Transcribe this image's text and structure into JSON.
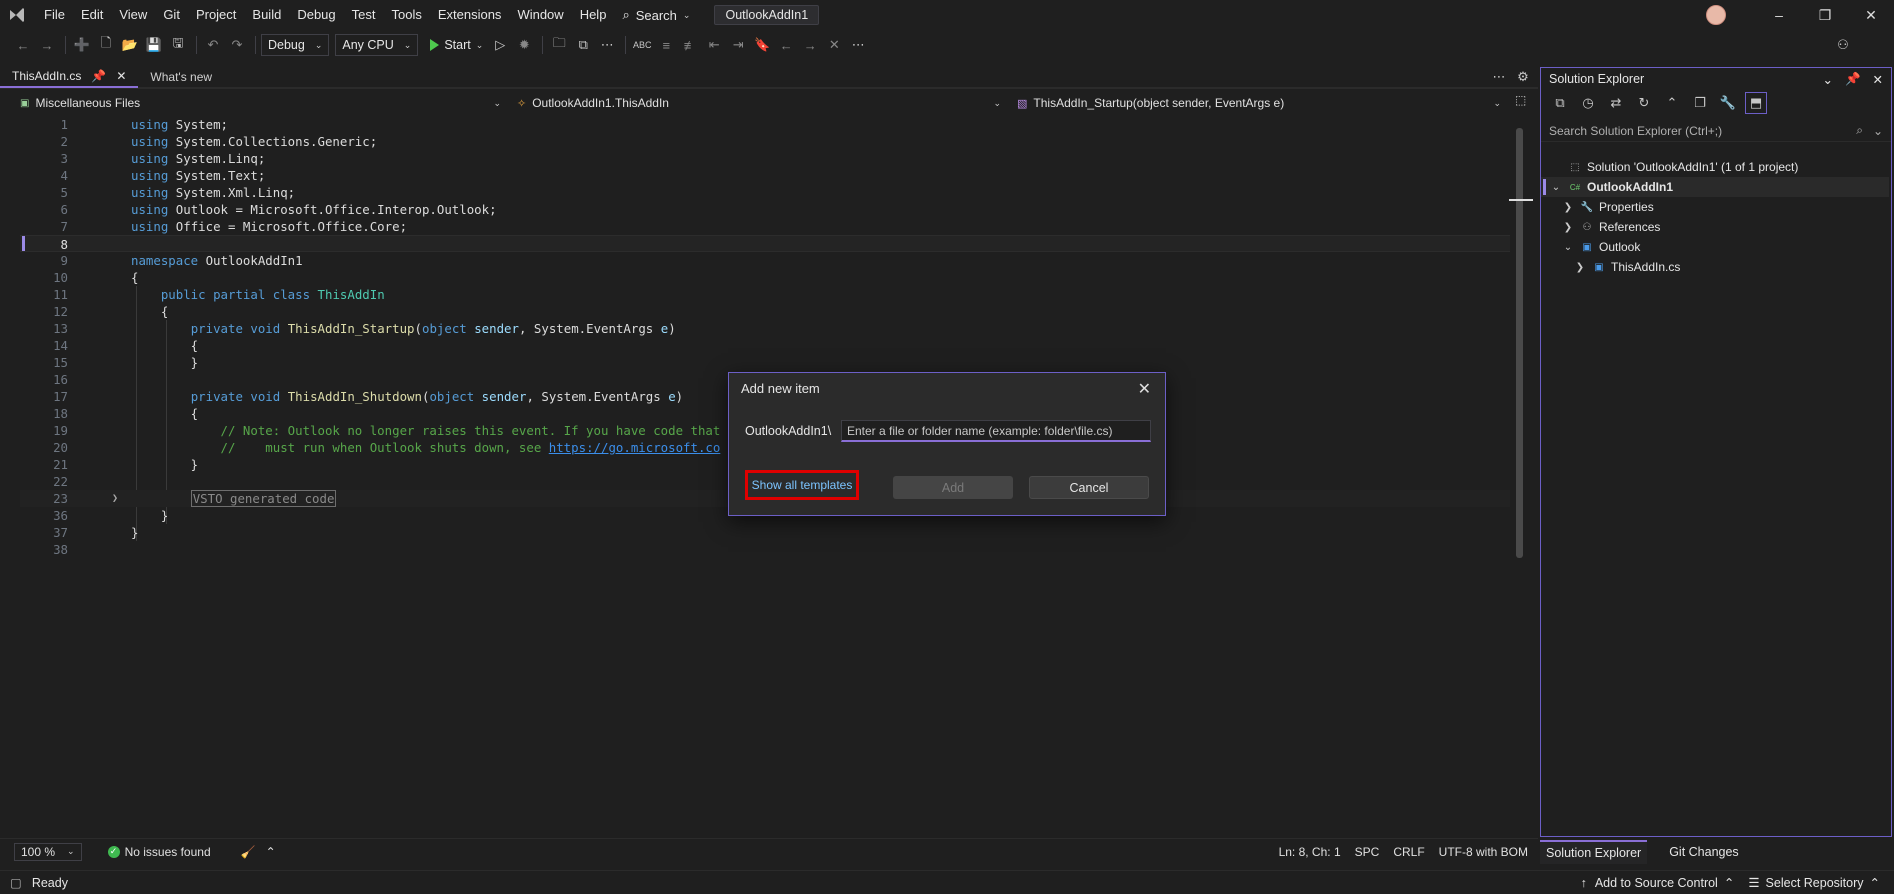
{
  "menubar": {
    "items": [
      "File",
      "Edit",
      "View",
      "Git",
      "Project",
      "Build",
      "Debug",
      "Test",
      "Tools",
      "Extensions",
      "Window",
      "Help"
    ],
    "search_label": "Search",
    "solution_name": "OutlookAddIn1"
  },
  "toolbar": {
    "configuration": "Debug",
    "platform": "Any CPU",
    "start_label": "Start"
  },
  "tabs": [
    {
      "label": "ThisAddIn.cs",
      "active": true
    },
    {
      "label": "What's new",
      "active": false
    }
  ],
  "navbar": {
    "project": "Miscellaneous Files",
    "type": "OutlookAddIn1.ThisAddIn",
    "member": "ThisAddIn_Startup(object sender, EventArgs e)"
  },
  "editor": {
    "line_numbers": [
      "1",
      "2",
      "3",
      "4",
      "5",
      "6",
      "7",
      "8",
      "9",
      "10",
      "11",
      "12",
      "13",
      "14",
      "15",
      "16",
      "17",
      "18",
      "19",
      "20",
      "21",
      "22",
      "23",
      "36",
      "37",
      "38"
    ],
    "current_line": "8",
    "comment_line_1": "// Note: Outlook no longer raises this event. If you have code that",
    "comment_line_2": "//    must run when Outlook shuts down, see ",
    "comment_link": "https://go.microsoft.co",
    "collapsed_region": "VSTO generated code"
  },
  "editor_status": {
    "zoom": "100 %",
    "issues": "No issues found",
    "position": "Ln: 8, Ch: 1",
    "whitespace": "SPC",
    "line_ending": "CRLF",
    "encoding": "UTF-8 with BOM"
  },
  "statusbar": {
    "state": "Ready",
    "source_control": "Add to Source Control",
    "repository": "Select Repository"
  },
  "solution_explorer": {
    "title": "Solution Explorer",
    "search_placeholder": "Search Solution Explorer (Ctrl+;)",
    "tree": [
      {
        "label": "Solution 'OutlookAddIn1' (1 of 1 project)"
      },
      {
        "label": "OutlookAddIn1"
      },
      {
        "label": "Properties"
      },
      {
        "label": "References"
      },
      {
        "label": "Outlook"
      },
      {
        "label": "ThisAddIn.cs"
      }
    ],
    "bottom_tabs": [
      "Solution Explorer",
      "Git Changes"
    ]
  },
  "dialog": {
    "title": "Add new item",
    "prefix": "OutlookAddIn1\\",
    "input_placeholder": "Enter a file or folder name (example: folder\\file.cs)",
    "input_value": "",
    "show_templates": "Show all templates",
    "add_label": "Add",
    "cancel_label": "Cancel"
  },
  "colors": {
    "accent": "#8a6fd6",
    "highlight_box": "#e00000",
    "ok_green": "#3fb950"
  }
}
